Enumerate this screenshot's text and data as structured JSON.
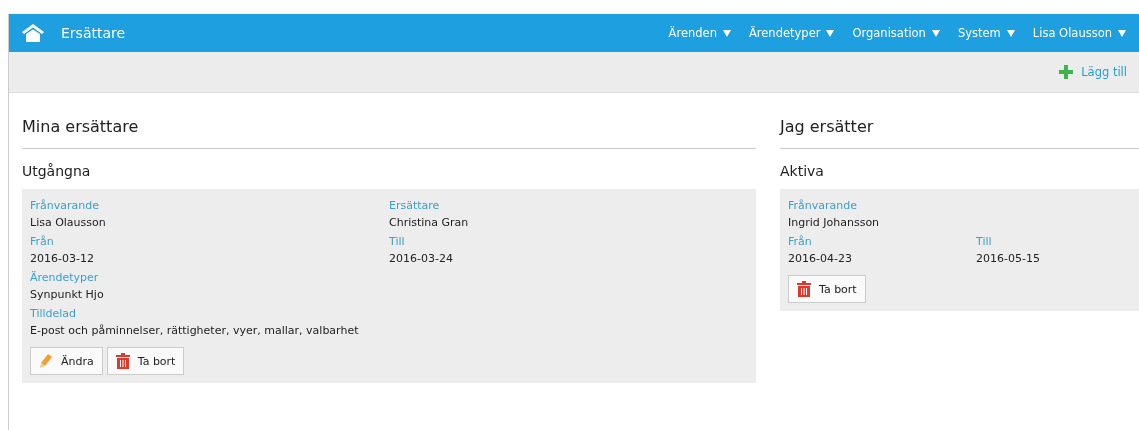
{
  "header": {
    "title": "Ersättare",
    "menu": [
      {
        "label": "Ärenden"
      },
      {
        "label": "Ärendetyper"
      },
      {
        "label": "Organisation"
      },
      {
        "label": "System"
      },
      {
        "label": "Lisa Olausson"
      }
    ]
  },
  "toolbar": {
    "add_label": "Lägg till"
  },
  "columns": [
    {
      "heading": "Mina ersättare",
      "sections": [
        {
          "heading": "Utgångna",
          "cards": [
            {
              "rows": [
                [
                  {
                    "label": "Frånvarande",
                    "value": "Lisa Olausson"
                  },
                  {
                    "label": "Ersättare",
                    "value": "Christina Gran"
                  }
                ],
                [
                  {
                    "label": "Från",
                    "value": "2016-03-12"
                  },
                  {
                    "label": "Till",
                    "value": "2016-03-24"
                  }
                ],
                [
                  {
                    "label": "Ärendetyper",
                    "value": "Synpunkt Hjo"
                  }
                ],
                [
                  {
                    "label": "Tilldelad",
                    "value": "E-post och påminnelser, rättigheter, vyer, mallar, valbarhet"
                  }
                ]
              ],
              "buttons": [
                {
                  "kind": "edit",
                  "label": "Ändra"
                },
                {
                  "kind": "delete",
                  "label": "Ta bort"
                }
              ]
            }
          ]
        }
      ]
    },
    {
      "heading": "Jag ersätter",
      "sections": [
        {
          "heading": "Aktiva",
          "cards": [
            {
              "rows": [
                [
                  {
                    "label": "Frånvarande",
                    "value": "Ingrid Johansson"
                  }
                ],
                [
                  {
                    "label": "Från",
                    "value": "2016-04-23"
                  },
                  {
                    "label": "Till",
                    "value": "2016-05-15"
                  }
                ]
              ],
              "buttons": [
                {
                  "kind": "delete",
                  "label": "Ta bort"
                }
              ]
            }
          ]
        }
      ]
    }
  ]
}
